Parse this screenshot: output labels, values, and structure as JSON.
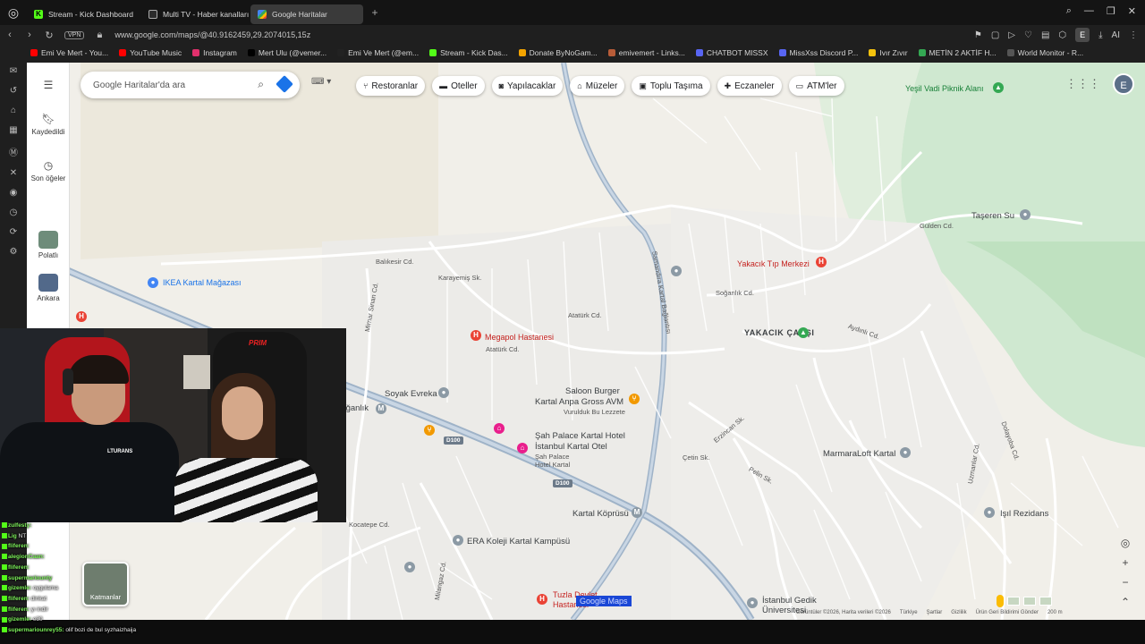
{
  "tabs": [
    {
      "label": "Stream - Kick Dashboard",
      "icon": "kick-icon",
      "active": false
    },
    {
      "label": "Multi TV - Haber kanalları",
      "icon": "tv-icon",
      "active": false
    },
    {
      "label": "Google Haritalar",
      "icon": "maps-icon",
      "active": true
    }
  ],
  "url": "www.google.com/maps/@40.9162459,29.2074015,15z",
  "vpn_label": "VPN",
  "profile_initial": "E",
  "toolbar_ai": "AI",
  "bookmarks": [
    {
      "label": "Emi Ve Mert - You...",
      "color": "#ff0000"
    },
    {
      "label": "YouTube Music",
      "color": "#ff0000"
    },
    {
      "label": "Instagram",
      "color": "#e1306c"
    },
    {
      "label": "Mert Ulu (@vemer...",
      "color": "#000000"
    },
    {
      "label": "Emi Ve Mert (@em...",
      "color": "#222222"
    },
    {
      "label": "Stream - Kick Das...",
      "color": "#53fc18"
    },
    {
      "label": "Donate ByNoGam...",
      "color": "#f4a400"
    },
    {
      "label": "emivemert - Links...",
      "color": "#b85c38"
    },
    {
      "label": "CHATBOT MISSX",
      "color": "#5865f2"
    },
    {
      "label": "MissXss Discord P...",
      "color": "#5865f2"
    },
    {
      "label": "Ivır Zıvır",
      "color": "#f4c20d"
    },
    {
      "label": "METİN 2 AKTİF H...",
      "color": "#34a853"
    },
    {
      "label": "World Monitor - R...",
      "color": "#555555"
    }
  ],
  "maps_panel": {
    "saved": "Kaydedildi",
    "recent": "Son öğeler",
    "place1": "Polatlı",
    "place2": "Ankara"
  },
  "search": {
    "placeholder": "Google Haritalar'da ara"
  },
  "chips": [
    {
      "label": "Restoranlar",
      "icon": "fork-icon"
    },
    {
      "label": "Oteller",
      "icon": "bed-icon"
    },
    {
      "label": "Yapılacaklar",
      "icon": "camera-icon"
    },
    {
      "label": "Müzeler",
      "icon": "museum-icon"
    },
    {
      "label": "Toplu Taşıma",
      "icon": "transit-icon"
    },
    {
      "label": "Eczaneler",
      "icon": "pharmacy-icon"
    },
    {
      "label": "ATM'ler",
      "icon": "atm-icon"
    }
  ],
  "account_initial": "E",
  "map_labels": {
    "yesil_vadi": "Yeşil Vadi Piknik Alanı",
    "taseren": "Taşeren Su",
    "gulden": "Gülden Cd.",
    "yakacik_tip": "Yakacık Tıp Merkezi",
    "yakacik_carsi": "YAKACIK ÇARŞI",
    "ikea": "IKEA Kartal Mağazası",
    "megapol": "Megapol Hastanesi",
    "soyak": "Soyak Evreka",
    "saloon1": "Saloon Burger",
    "saloon2": "Kartal Anpa Gross AVM",
    "saloon3": "Vurulduk Bu Lezzete",
    "sah1": "Şah Palace Kartal Hotel",
    "sah2": "İstanbul Kartal Otel",
    "sah3": "Şah Palace",
    "sah4": "Hotel Kartal",
    "kartal_koprusu": "Kartal Köprüsü",
    "era": "ERA Koleji Kartal Kampüsü",
    "tuzla1": "Tuzla Devlet",
    "tuzla2": "Hastanesi",
    "marmaraloft": "MarmaraLoft Kartal",
    "isil": "Işıl Rezidans",
    "gedik1": "İstanbul Gedik",
    "gedik2": "Üniversitesi",
    "soganlik": "Soğanlık",
    "soganlik_cd": "Soğanlık Cd.",
    "ataturk": "Atatürk Cd.",
    "balikesir": "Balıkesir Cd.",
    "karayemis": "Karayemiş Sk.",
    "samandira": "Samandıra Kartal Bağlantısı",
    "mimar_sinan": "Mimar Sinan Cd.",
    "kocatepe": "Kocatepe Cd.",
    "milangaz": "Milangaz Cd.",
    "yunus": "Yunus Cd.",
    "ankara_cd": "Ankara Cd.",
    "ayazsergi": "Aydınlı Cd.",
    "cetin": "Çetin Sk.",
    "erzincan": "Erzincan Sk.",
    "dolayoba": "Dolayoba Cd.",
    "uzmanlar": "Uzmanlar Cd.",
    "pelin": "Pelin Sk.",
    "d100": "D100",
    "d100b": "D100"
  },
  "watermark": "Google Maps",
  "layers_label": "Katmanlar",
  "bottom_bar": [
    "Görüntüler ©2026, Harita verileri ©2026",
    "Türkiye",
    "Şartlar",
    "Gizlilik",
    "Ürün Geri Bildirimi Gönder",
    "200 m"
  ],
  "webcam": {
    "chair_brand": "PRIM",
    "shirt_text": "LTURANS"
  },
  "chat": [
    {
      "user": "zulfesty:",
      "text": ""
    },
    {
      "user": "Lig",
      "text": "NT"
    },
    {
      "user": "fliferen:",
      "text": ""
    },
    {
      "user": "alegionCaan:",
      "text": ""
    },
    {
      "user": "fliferen:",
      "text": ""
    },
    {
      "user": "supermariounty",
      "text": ""
    },
    {
      "user": "gizemle:",
      "text": "oygulama"
    },
    {
      "user": "fliferen:",
      "text": "dinkat"
    },
    {
      "user": "fliferen:",
      "text": "yı indir"
    },
    {
      "user": "gizemle:",
      "text": "e30"
    },
    {
      "user": "supermariounrey55:",
      "text": "olif bozi de bul syzhaizhaija"
    }
  ]
}
